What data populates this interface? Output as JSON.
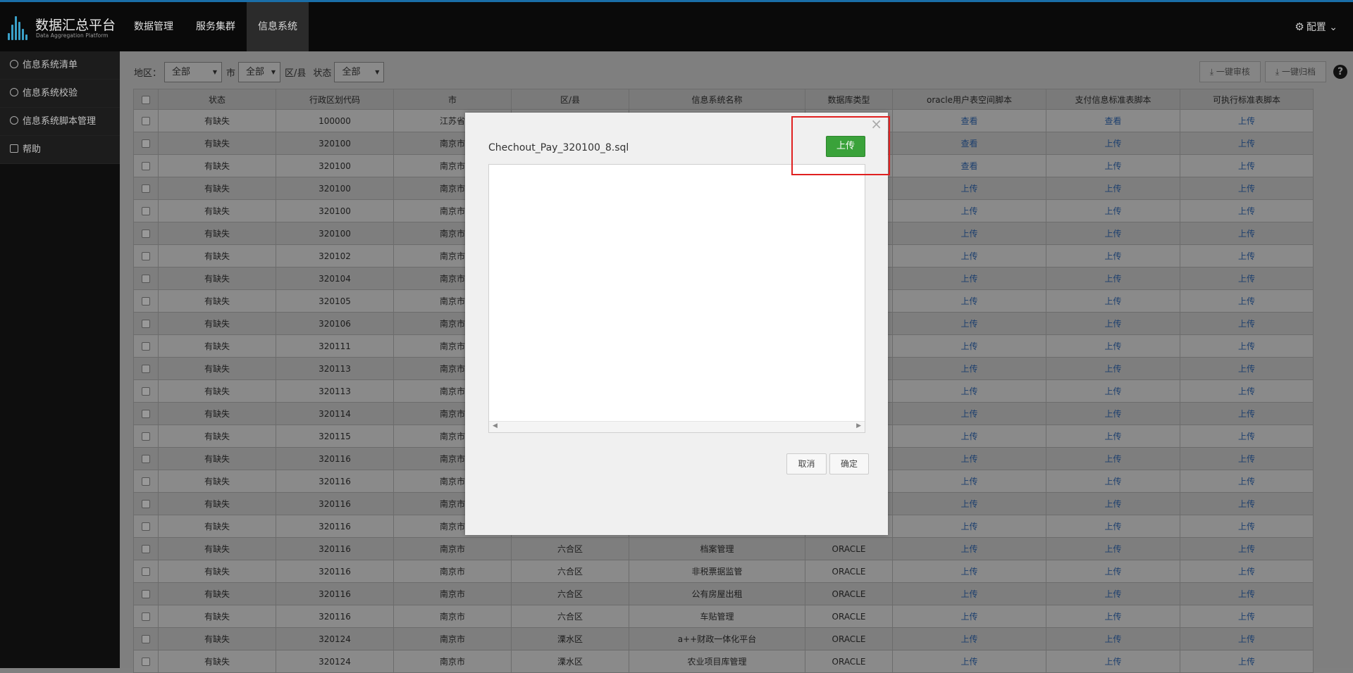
{
  "app": {
    "title": "数据汇总平台",
    "subtitle": "Data Aggregation Platform"
  },
  "nav": {
    "items": [
      "数据管理",
      "服务集群",
      "信息系统"
    ],
    "active": 2
  },
  "config": {
    "label": "配置"
  },
  "sidebar": {
    "items": [
      "信息系统清单",
      "信息系统校验",
      "信息系统脚本管理",
      "帮助"
    ]
  },
  "filters": {
    "region_label": "地区：",
    "region_value": "全部",
    "city_label": "市",
    "city_value": "全部",
    "district_label": "区/县",
    "status_label": "状态",
    "status_value": "全部"
  },
  "actions": {
    "review_label": "一键审核",
    "archive_label": "一键归档"
  },
  "table": {
    "headers": [
      "状态",
      "行政区划代码",
      "市",
      "区/县",
      "信息系统名称",
      "数据库类型",
      "oracle用户表空间脚本",
      "支付信息标准表脚本",
      "可执行标准表脚本"
    ],
    "rows": [
      [
        "有缺失",
        "100000",
        "江苏省",
        "",
        "",
        "",
        "查看",
        "查看",
        "上传"
      ],
      [
        "有缺失",
        "320100",
        "南京市",
        "",
        "",
        "",
        "查看",
        "上传",
        "上传"
      ],
      [
        "有缺失",
        "320100",
        "南京市",
        "",
        "",
        "",
        "查看",
        "上传",
        "上传"
      ],
      [
        "有缺失",
        "320100",
        "南京市",
        "",
        "",
        "",
        "上传",
        "上传",
        "上传"
      ],
      [
        "有缺失",
        "320100",
        "南京市",
        "",
        "",
        "",
        "上传",
        "上传",
        "上传"
      ],
      [
        "有缺失",
        "320100",
        "南京市",
        "",
        "",
        "",
        "上传",
        "上传",
        "上传"
      ],
      [
        "有缺失",
        "320102",
        "南京市",
        "",
        "",
        "",
        "上传",
        "上传",
        "上传"
      ],
      [
        "有缺失",
        "320104",
        "南京市",
        "",
        "",
        "",
        "上传",
        "上传",
        "上传"
      ],
      [
        "有缺失",
        "320105",
        "南京市",
        "",
        "",
        "",
        "上传",
        "上传",
        "上传"
      ],
      [
        "有缺失",
        "320106",
        "南京市",
        "",
        "",
        "",
        "上传",
        "上传",
        "上传"
      ],
      [
        "有缺失",
        "320111",
        "南京市",
        "",
        "",
        "",
        "上传",
        "上传",
        "上传"
      ],
      [
        "有缺失",
        "320113",
        "南京市",
        "",
        "",
        "",
        "上传",
        "上传",
        "上传"
      ],
      [
        "有缺失",
        "320113",
        "南京市",
        "",
        "",
        "",
        "上传",
        "上传",
        "上传"
      ],
      [
        "有缺失",
        "320114",
        "南京市",
        "",
        "",
        "",
        "上传",
        "上传",
        "上传"
      ],
      [
        "有缺失",
        "320115",
        "南京市",
        "",
        "",
        "",
        "上传",
        "上传",
        "上传"
      ],
      [
        "有缺失",
        "320116",
        "南京市",
        "",
        "",
        "",
        "上传",
        "上传",
        "上传"
      ],
      [
        "有缺失",
        "320116",
        "南京市",
        "",
        "",
        "",
        "上传",
        "上传",
        "上传"
      ],
      [
        "有缺失",
        "320116",
        "南京市",
        "",
        "",
        "",
        "上传",
        "上传",
        "上传"
      ],
      [
        "有缺失",
        "320116",
        "南京市",
        "",
        "",
        "",
        "上传",
        "上传",
        "上传"
      ],
      [
        "有缺失",
        "320116",
        "南京市",
        "六合区",
        "档案管理",
        "ORACLE",
        "上传",
        "上传",
        "上传"
      ],
      [
        "有缺失",
        "320116",
        "南京市",
        "六合区",
        "非税票据监管",
        "ORACLE",
        "上传",
        "上传",
        "上传"
      ],
      [
        "有缺失",
        "320116",
        "南京市",
        "六合区",
        "公有房屋出租",
        "ORACLE",
        "上传",
        "上传",
        "上传"
      ],
      [
        "有缺失",
        "320116",
        "南京市",
        "六合区",
        "车贴管理",
        "ORACLE",
        "上传",
        "上传",
        "上传"
      ],
      [
        "有缺失",
        "320124",
        "南京市",
        "溧水区",
        "a++财政一体化平台",
        "ORACLE",
        "上传",
        "上传",
        "上传"
      ],
      [
        "有缺失",
        "320124",
        "南京市",
        "溧水区",
        "农业项目库管理",
        "ORACLE",
        "上传",
        "上传",
        "上传"
      ]
    ]
  },
  "modal": {
    "filename": "Chechout_Pay_320100_8.sql",
    "upload_label": "上传",
    "cancel_label": "取消",
    "ok_label": "确定",
    "close_glyph": "×"
  },
  "colors": {
    "accent": "#1a6ea8",
    "upload_green": "#3aa23a",
    "highlight_red": "#e02020"
  }
}
